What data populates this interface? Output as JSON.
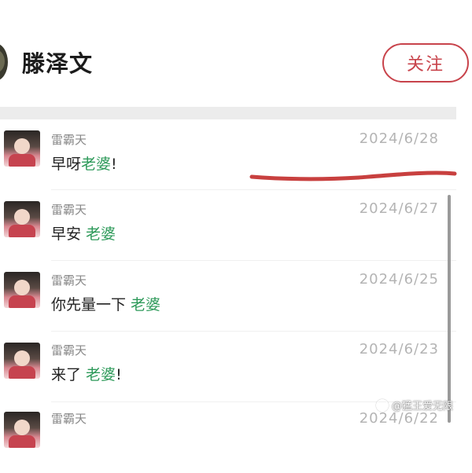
{
  "header": {
    "name": "滕泽文",
    "follow_label": "关注"
  },
  "items": [
    {
      "user": "雷霸天",
      "date": "2024/6/28",
      "msg_prefix": "早呀",
      "msg_keyword": "老婆",
      "msg_suffix": "!"
    },
    {
      "user": "雷霸天",
      "date": "2024/6/27",
      "msg_prefix": "早安 ",
      "msg_keyword": "老婆",
      "msg_suffix": ""
    },
    {
      "user": "雷霸天",
      "date": "2024/6/25",
      "msg_prefix": "你先量一下 ",
      "msg_keyword": "老婆",
      "msg_suffix": ""
    },
    {
      "user": "雷霸天",
      "date": "2024/6/23",
      "msg_prefix": "来了 ",
      "msg_keyword": "老婆",
      "msg_suffix": "!"
    },
    {
      "user": "雷霸天",
      "date": "2024/6/22"
    }
  ],
  "watermark": "@猛王爱无限",
  "colors": {
    "accent_red": "#c8434b",
    "keyword_green": "#2e9a5a",
    "annotation_red": "#c8403f"
  }
}
